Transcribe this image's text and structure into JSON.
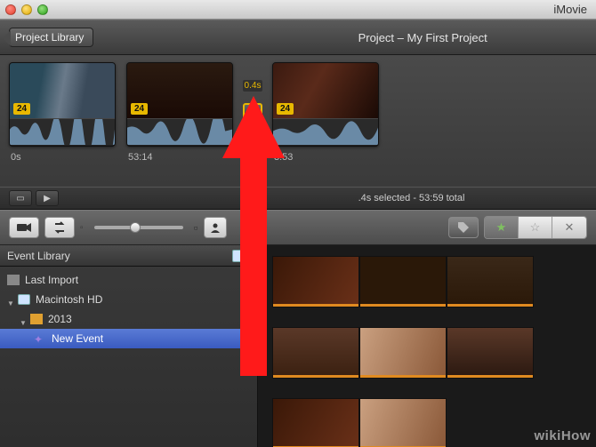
{
  "app": {
    "title": "iMovie"
  },
  "toolbar": {
    "back_label": "Project Library",
    "project_title": "Project – My First Project"
  },
  "timeline": {
    "clips": [
      {
        "badge": "24",
        "timecode": "0s"
      },
      {
        "badge": "24",
        "timecode": "53:14"
      },
      {
        "badge": "24",
        "timecode": "3:53"
      }
    ],
    "transition": {
      "duration": "0.4s"
    }
  },
  "status": {
    "text": ".4s selected - 53:59 total"
  },
  "midbar": {
    "camera_label": "camera",
    "swap_label": "swap"
  },
  "sidebar": {
    "header": "Event Library",
    "items": [
      {
        "label": "Last Import",
        "icon": "camera",
        "indent": 0
      },
      {
        "label": "Macintosh HD",
        "icon": "hd",
        "indent": 0,
        "disclosure": "open"
      },
      {
        "label": "2013",
        "icon": "calendar",
        "indent": 1,
        "disclosure": "open"
      },
      {
        "label": "New Event",
        "icon": "star",
        "indent": 2,
        "selected": true
      }
    ]
  },
  "watermark": "wikiHow"
}
